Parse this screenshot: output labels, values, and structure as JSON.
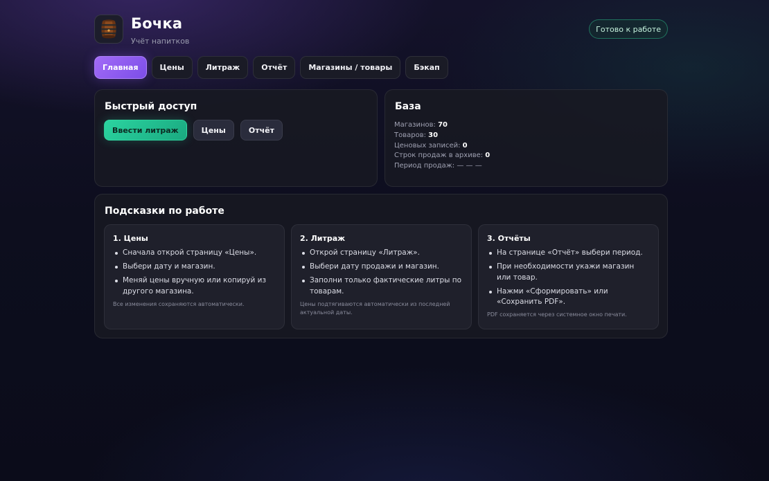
{
  "header": {
    "title": "Бочка",
    "subtitle": "Учёт напитков",
    "logo_icon": "barrel-icon",
    "status": "Готово к работе"
  },
  "tabs": [
    {
      "label": "Главная",
      "active": true
    },
    {
      "label": "Цены",
      "active": false
    },
    {
      "label": "Литраж",
      "active": false
    },
    {
      "label": "Отчёт",
      "active": false
    },
    {
      "label": "Магазины / товары",
      "active": false
    },
    {
      "label": "Бэкап",
      "active": false
    }
  ],
  "quick": {
    "title": "Быстрый доступ",
    "buttons": [
      "Ввести литраж",
      "Цены",
      "Отчёт"
    ]
  },
  "base": {
    "title": "База",
    "stats": [
      {
        "label": "Магазинов:",
        "value": "70"
      },
      {
        "label": "Товаров:",
        "value": "30"
      },
      {
        "label": "Ценовых записей:",
        "value": "0"
      },
      {
        "label": "Строк продаж в архиве:",
        "value": "0"
      },
      {
        "label": "Период продаж:",
        "value": "— — —"
      }
    ]
  },
  "tips": {
    "title": "Подсказки по работе",
    "columns": [
      {
        "title": "1. Цены",
        "items": [
          "Сначала открой страницу «Цены».",
          "Выбери дату и магазин.",
          "Меняй цены вручную или копируй из другого магазина."
        ],
        "note": "Все изменения сохраняются автоматически."
      },
      {
        "title": "2. Литраж",
        "items": [
          "Открой страницу «Литраж».",
          "Выбери дату продажи и магазин.",
          "Заполни только фактические литры по товарам."
        ],
        "note": "Цены подтягиваются автоматически из последней актуальной даты."
      },
      {
        "title": "3. Отчёты",
        "items": [
          "На странице «Отчёт» выбери период.",
          "При необходимости укажи магазин или товар.",
          "Нажми «Сформировать» или «Сохранить PDF»."
        ],
        "note": "PDF сохраняется через системное окно печати."
      }
    ]
  },
  "colors": {
    "accent_purple": "#8b5cf6",
    "accent_green": "#22c997",
    "background": "#0d0e1e"
  }
}
